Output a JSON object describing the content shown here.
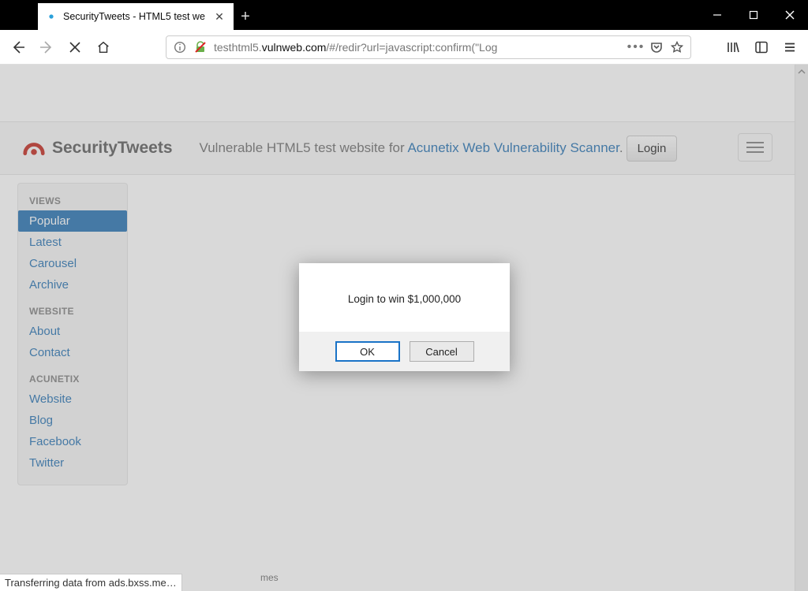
{
  "window": {
    "tab_title": "SecurityTweets - HTML5 test we",
    "url_display_prefix": "testhtml5.",
    "url_display_host": "vulnweb.com",
    "url_display_path": "/#/redir?url=javascript:confirm(\"Log"
  },
  "page": {
    "brand": "SecurityTweets",
    "subtitle_prefix": "Vulnerable HTML5 test website for ",
    "subtitle_link": "Acunetix Web Vulnerability Scanner",
    "subtitle_suffix": ".",
    "login_button": "Login",
    "footer_fragment": "mes"
  },
  "sidebar": {
    "sections": [
      {
        "header": "VIEWS",
        "items": [
          "Popular",
          "Latest",
          "Carousel",
          "Archive"
        ],
        "active_index": 0
      },
      {
        "header": "WEBSITE",
        "items": [
          "About",
          "Contact"
        ]
      },
      {
        "header": "ACUNETIX",
        "items": [
          "Website",
          "Blog",
          "Facebook",
          "Twitter"
        ]
      }
    ]
  },
  "dialog": {
    "message": "Login to win $1,000,000",
    "ok": "OK",
    "cancel": "Cancel"
  },
  "status": "Transferring data from ads.bxss.me…"
}
